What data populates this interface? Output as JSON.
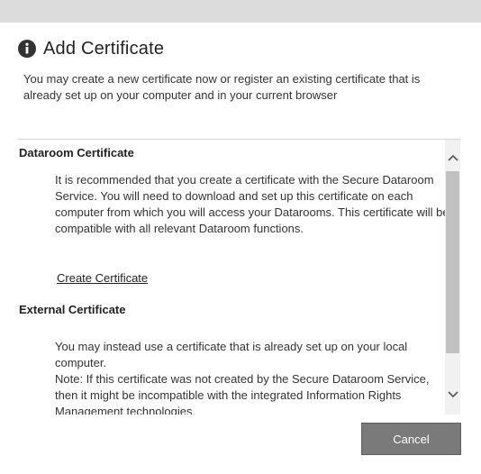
{
  "dialog": {
    "title": "Add Certificate",
    "intro": "You may create a new certificate now or register an existing certificate that is already set up on your computer and in your current browser",
    "info_icon": "info-icon"
  },
  "sections": {
    "dataroom": {
      "title": "Dataroom Certificate",
      "body": "It is recommended that you create a certificate with the Secure Dataroom Service. You will need to download and set up this certificate on each computer from which you will access your Datarooms. This certificate will be compatible with all relevant Dataroom functions.",
      "link_label": "Create Certificate"
    },
    "external": {
      "title": "External Certificate",
      "body_line1": "You may instead use a certificate that is already set up on your local computer.",
      "body_line2": "Note: If this certificate was not created by the Secure Dataroom Service, then it might be incompatible with the integrated Information Rights Management technologies."
    }
  },
  "footer": {
    "cancel_label": "Cancel"
  },
  "colors": {
    "top_bar": "#dcdcdc",
    "button": "#7a7a7a",
    "scroll_thumb": "#c1c1c1",
    "scroll_track": "#f1f1f1"
  }
}
